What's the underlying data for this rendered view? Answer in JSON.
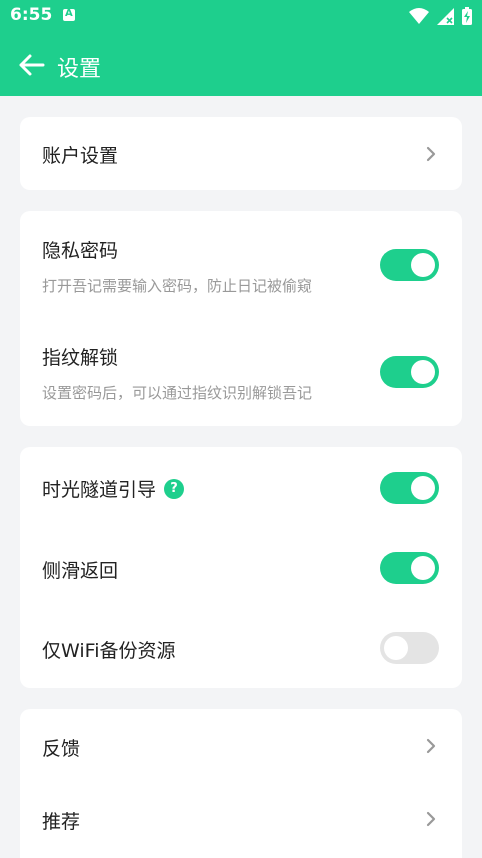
{
  "status_bar": {
    "time": "6:55",
    "notification_icon": "app-notification-icon",
    "icons": [
      "wifi-icon",
      "cellular-no-data-icon",
      "battery-charging-icon"
    ]
  },
  "app_bar": {
    "back_icon": "arrow-left-icon",
    "title": "设置"
  },
  "sections": {
    "account": {
      "title": "账户设置"
    },
    "security": {
      "privacy_password": {
        "title": "隐私密码",
        "subtitle": "打开吾记需要输入密码，防止日记被偷窥",
        "enabled": true
      },
      "fingerprint_unlock": {
        "title": "指纹解锁",
        "subtitle": "设置密码后，可以通过指纹识别解锁吾记",
        "enabled": true
      }
    },
    "general": {
      "time_tunnel_guide": {
        "title": "时光隧道引导",
        "help_label": "?",
        "enabled": true
      },
      "swipe_back": {
        "title": "侧滑返回",
        "enabled": true
      },
      "wifi_only_backup": {
        "title": "仅WiFi备份资源",
        "enabled": false
      }
    },
    "misc": {
      "feedback": {
        "title": "反馈"
      },
      "recommend": {
        "title": "推荐"
      }
    }
  },
  "colors": {
    "accent": "#1ecf8d",
    "background": "#f3f4f6",
    "toggle_off": "#e4e4e4"
  }
}
